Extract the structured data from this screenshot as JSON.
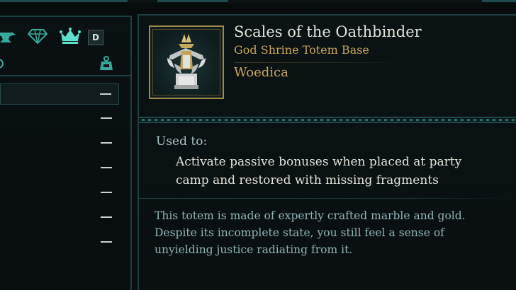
{
  "inventory": {
    "tab_hotkey": "D",
    "rows": [
      {
        "quantity": "—",
        "selected": true
      },
      {
        "quantity": "—",
        "selected": false
      },
      {
        "quantity": "—",
        "selected": false
      },
      {
        "quantity": "—",
        "selected": false
      },
      {
        "quantity": "—",
        "selected": false
      },
      {
        "quantity": "—",
        "selected": false
      },
      {
        "quantity": "—",
        "selected": false
      }
    ]
  },
  "item": {
    "name": "Scales of the Oathbinder",
    "type": "God Shrine Totem Base",
    "faction": "Woedica",
    "used_label": "Used to:",
    "used_text": "Activate passive bonuses when placed at party camp and restored with missing fragments",
    "lore": "This totem is made of expertly crafted marble and gold. Despite its incomplete state, you still feel a sense of unyielding justice radiating from it."
  },
  "colors": {
    "accent_teal": "#1c3f42",
    "gold": "#c9a65a",
    "title_text": "#e3e3dc",
    "lore_text": "#8fb3b5"
  },
  "icons": [
    "anvil-icon",
    "gem-icon",
    "crown-icon",
    "weight-icon",
    "item-totem-icon",
    "quest-ring-icon"
  ]
}
